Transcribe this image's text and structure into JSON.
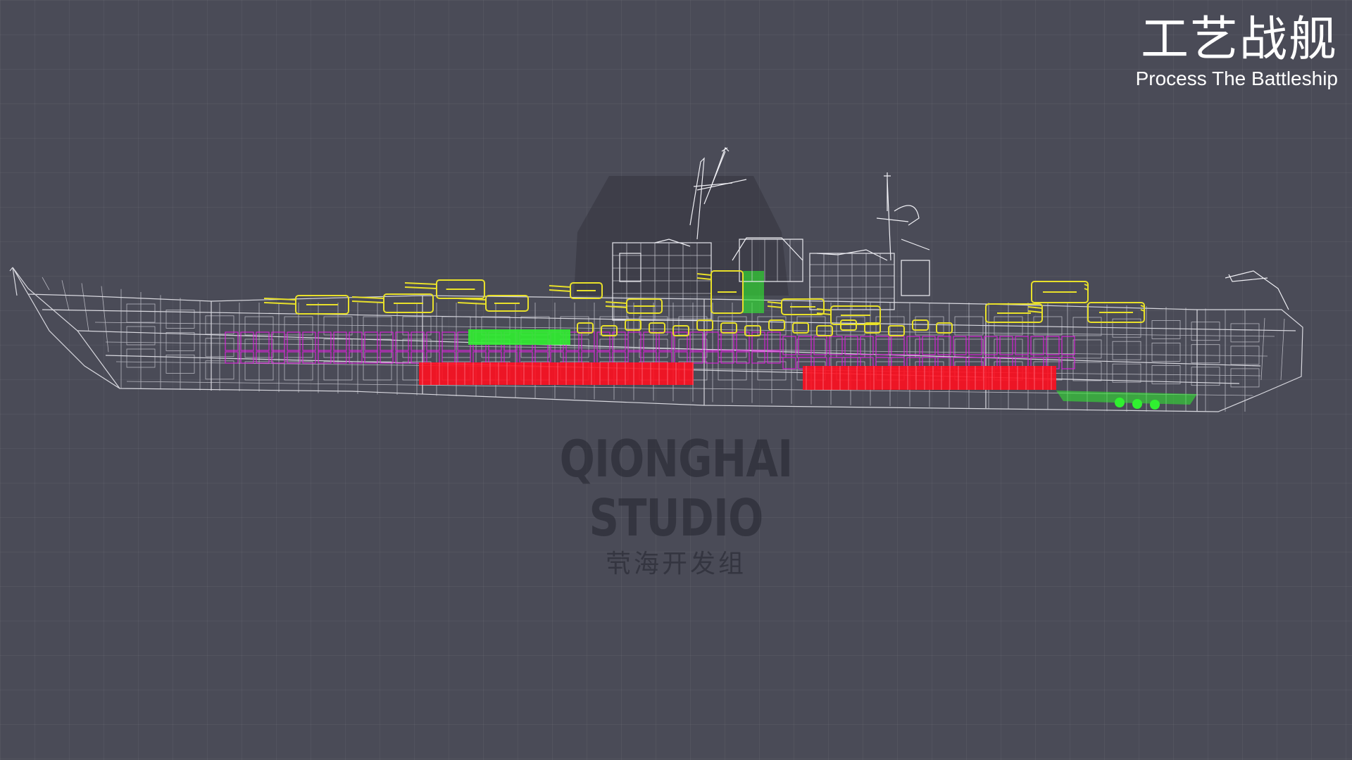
{
  "header": {
    "title_zh": "工艺战舰",
    "title_en": "Process The Battleship"
  },
  "watermark": {
    "studio_en": "QIONGHAI STUDIO",
    "studio_zh": "茕海开发组"
  },
  "colors": {
    "background": "#4a4b57",
    "wireframe": "#ffffff",
    "turrets": "#e8e02a",
    "compartments": "#e020e0",
    "magazines": "#ff1020",
    "machinery": "#30f030"
  }
}
